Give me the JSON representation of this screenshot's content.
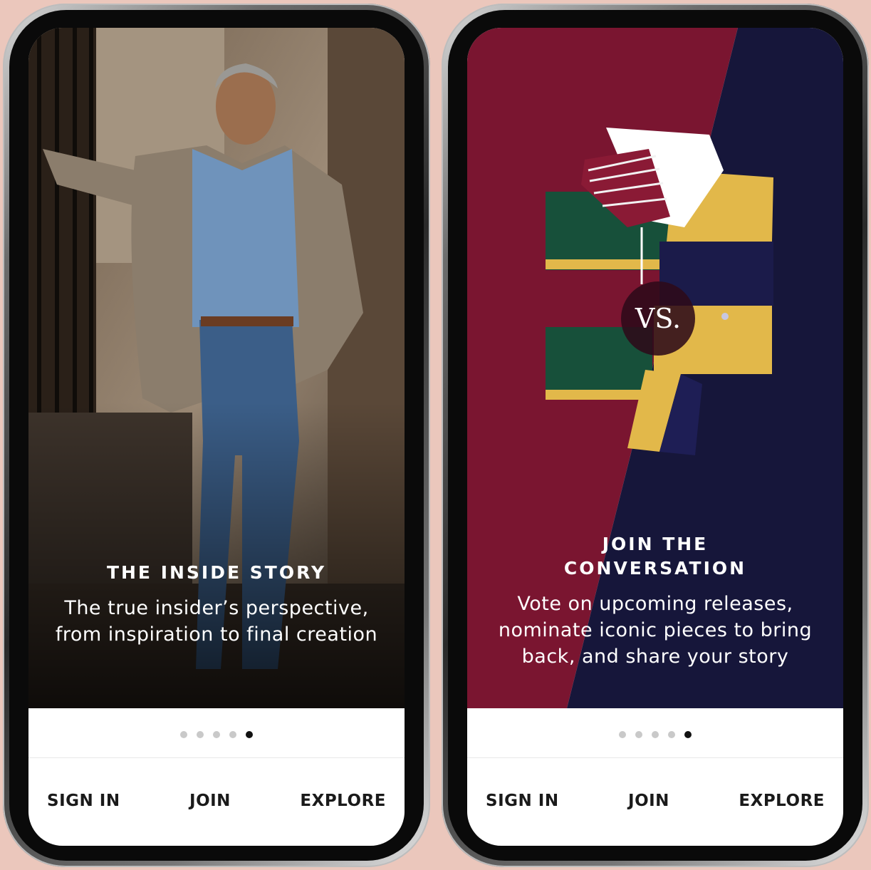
{
  "screens": [
    {
      "title": "THE INSIDE STORY",
      "description": "The true insider’s perspective, from inspiration to final creation",
      "pagination": {
        "count": 5,
        "active": 5
      },
      "nav": {
        "sign_in": "SIGN IN",
        "join": "JOIN",
        "explore": "EXPLORE"
      }
    },
    {
      "title": "JOIN THE\nCONVERSATION",
      "description": "Vote on upcoming releases, nominate iconic pieces to bring back, and share your story",
      "badge": "VS.",
      "pagination": {
        "count": 5,
        "active": 5
      },
      "nav": {
        "sign_in": "SIGN IN",
        "join": "JOIN",
        "explore": "EXPLORE"
      }
    }
  ],
  "colors": {
    "background": "#ebc7bc",
    "burgundy": "#7a1530",
    "navy": "#16163a",
    "gold": "#e2b84a",
    "green": "#17503a"
  }
}
